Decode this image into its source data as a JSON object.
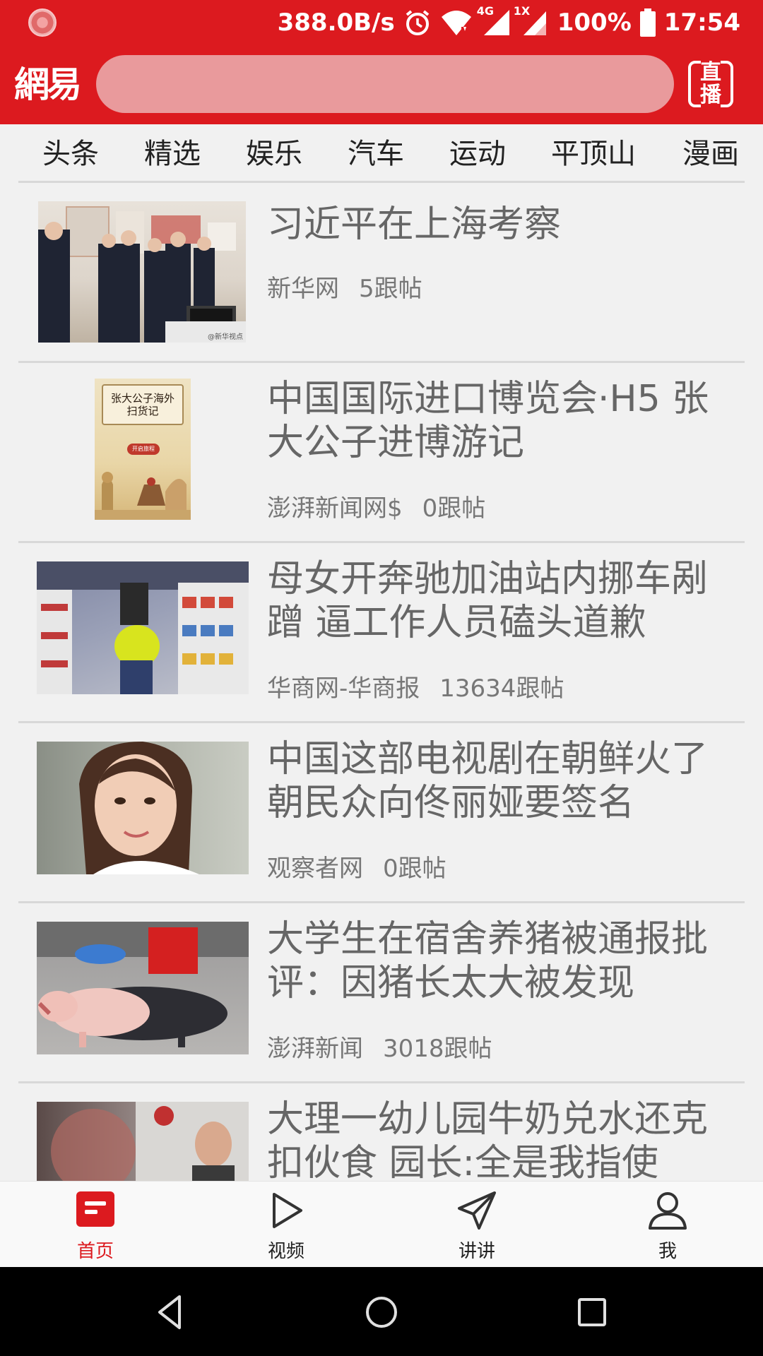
{
  "status_bar": {
    "speed": "388.0B/s",
    "network_4g": "4G",
    "network_1x": "1X",
    "battery": "100%",
    "time": "17:54"
  },
  "header": {
    "logo": "網易",
    "search_placeholder": "",
    "live_label": "直播",
    "brand_color": "#dc1a1f"
  },
  "tabs": [
    "头条",
    "精选",
    "娱乐",
    "汽车",
    "运动",
    "平顶山",
    "漫画"
  ],
  "news": [
    {
      "title": "习近平在上海考察",
      "source": "新华网",
      "comments": "5跟帖"
    },
    {
      "title": "中国国际进口博览会·H5 张大公子进博游记",
      "source": "澎湃新闻网$",
      "comments": "0跟帖"
    },
    {
      "title": "母女开奔驰加油站内挪车剐蹭 逼工作人员磕头道歉",
      "source": "华商网-华商报",
      "comments": "13634跟帖"
    },
    {
      "title": "中国这部电视剧在朝鲜火了 朝民众向佟丽娅要签名",
      "source": "观察者网",
      "comments": "0跟帖"
    },
    {
      "title": "大学生在宿舍养猪被通报批评：因猪长太大被发现",
      "source": "澎湃新闻",
      "comments": "3018跟帖"
    },
    {
      "title": "大理一幼儿园牛奶兑水还克扣伙食 园长:全是我指使",
      "source": "",
      "comments": ""
    }
  ],
  "thumbs": {
    "poster_text": "张大公子海外扫货记",
    "poster_button": "开启旅程",
    "watermark": "@新华视点"
  },
  "bottom_nav": {
    "home": "首页",
    "video": "视频",
    "talk": "讲讲",
    "me": "我"
  }
}
